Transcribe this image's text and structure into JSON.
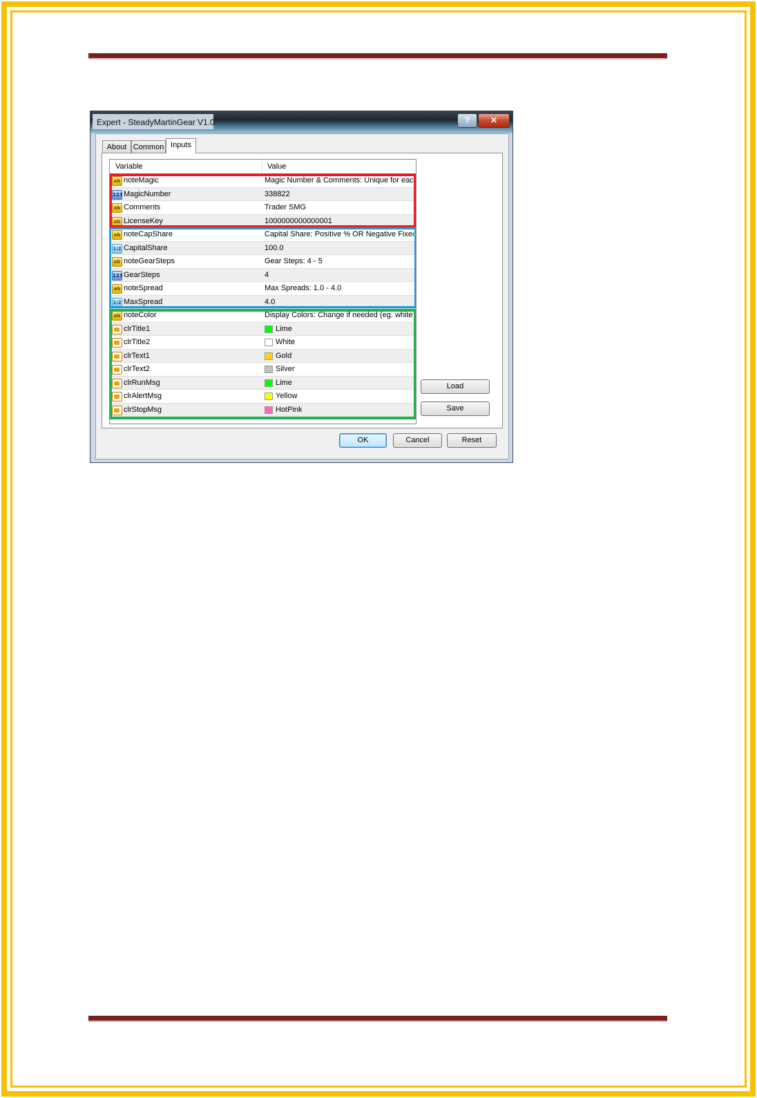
{
  "window": {
    "title": "Expert - SteadyMartinGear V1.0",
    "help_label": "?",
    "close_label": "✕"
  },
  "tabs": [
    {
      "label": "About",
      "active": false
    },
    {
      "label": "Common",
      "active": false
    },
    {
      "label": "Inputs",
      "active": true
    }
  ],
  "grid": {
    "col_variable": "Variable",
    "col_value": "Value",
    "rows": [
      {
        "type": "string",
        "icon": "ab",
        "variable": "noteMagic",
        "value": "Magic Number & Comments: Unique for eac..."
      },
      {
        "type": "int",
        "icon": "123",
        "variable": "MagicNumber",
        "value": "338822"
      },
      {
        "type": "string",
        "icon": "ab",
        "variable": "Comments",
        "value": "Trader SMG"
      },
      {
        "type": "string",
        "icon": "ab",
        "variable": "LicenseKey",
        "value": "1000000000000001"
      },
      {
        "type": "string",
        "icon": "ab",
        "variable": "noteCapShare",
        "value": "Capital Share: Positive % OR Negative Fixed..."
      },
      {
        "type": "double",
        "icon": "1/2",
        "variable": "CapitalShare",
        "value": "100.0"
      },
      {
        "type": "string",
        "icon": "ab",
        "variable": "noteGearSteps",
        "value": "Gear Steps: 4 - 5"
      },
      {
        "type": "int",
        "icon": "123",
        "variable": "GearSteps",
        "value": "4"
      },
      {
        "type": "string",
        "icon": "ab",
        "variable": "noteSpread",
        "value": "Max Spreads: 1.0 - 4.0"
      },
      {
        "type": "double",
        "icon": "1/2",
        "variable": "MaxSpread",
        "value": "4.0"
      },
      {
        "type": "string",
        "icon": "ab",
        "variable": "noteColor",
        "value": "Display Colors: Change if needed (eg. white ..."
      },
      {
        "type": "color",
        "icon": "color",
        "variable": "clrTitle1",
        "value": "Lime",
        "swatch": "#00ff00"
      },
      {
        "type": "color",
        "icon": "color",
        "variable": "clrTitle2",
        "value": "White",
        "swatch": "#ffffff"
      },
      {
        "type": "color",
        "icon": "color",
        "variable": "clrText1",
        "value": "Gold",
        "swatch": "#ffd700"
      },
      {
        "type": "color",
        "icon": "color",
        "variable": "clrText2",
        "value": "Silver",
        "swatch": "#c0c0c0"
      },
      {
        "type": "color",
        "icon": "color",
        "variable": "clrRunMsg",
        "value": "Lime",
        "swatch": "#00ff00"
      },
      {
        "type": "color",
        "icon": "color",
        "variable": "clrAlertMsg",
        "value": "Yellow",
        "swatch": "#ffff00"
      },
      {
        "type": "color",
        "icon": "color",
        "variable": "clrStopMsg",
        "value": "HotPink",
        "swatch": "#ff69b4"
      }
    ]
  },
  "highlight_colors": {
    "group1": "#ed1c24",
    "group2": "#1a9be0",
    "group3": "#22b14c"
  },
  "buttons": {
    "load": "Load",
    "save": "Save",
    "ok": "OK",
    "cancel": "Cancel",
    "reset": "Reset"
  }
}
